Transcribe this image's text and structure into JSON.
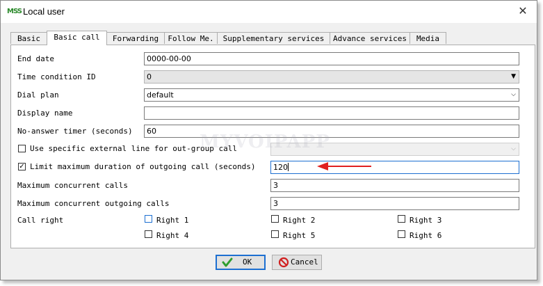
{
  "window": {
    "title": "Local user",
    "app_icon_text": "MSS"
  },
  "tabs": [
    {
      "label": "Basic"
    },
    {
      "label": "Basic call"
    },
    {
      "label": "Forwarding"
    },
    {
      "label": "Follow Me."
    },
    {
      "label": "Supplementary services"
    },
    {
      "label": "Advance services"
    },
    {
      "label": "Media"
    }
  ],
  "active_tab": "Basic call",
  "form": {
    "end_date": {
      "label": "End date",
      "value": "0000-00-00"
    },
    "time_condition": {
      "label": "Time condition ID",
      "value": "0"
    },
    "dial_plan": {
      "label": "Dial plan",
      "value": "default"
    },
    "display_name": {
      "label": "Display name",
      "value": ""
    },
    "no_answer_timer": {
      "label": "No-answer timer (seconds)",
      "value": "60"
    },
    "use_external_line": {
      "label": "Use specific external line for out-group call",
      "checked": false,
      "value": ""
    },
    "limit_duration": {
      "label": "Limit maximum duration of outgoing call (seconds)",
      "checked": true,
      "value": "120"
    },
    "max_concurrent": {
      "label": "Maximum concurrent calls",
      "value": "3"
    },
    "max_concurrent_out": {
      "label": "Maximum concurrent outgoing calls",
      "value": "3"
    },
    "call_right": {
      "label": "Call right",
      "items": [
        {
          "label": "Right 1",
          "checked": false
        },
        {
          "label": "Right 2",
          "checked": false
        },
        {
          "label": "Right 3",
          "checked": false
        },
        {
          "label": "Right 4",
          "checked": false
        },
        {
          "label": "Right 5",
          "checked": false
        },
        {
          "label": "Right 6",
          "checked": false
        }
      ]
    }
  },
  "buttons": {
    "ok": "OK",
    "cancel": "Cancel"
  },
  "watermark": "MYVOIPAPP",
  "colors": {
    "focus_border": "#1c6fd1",
    "annotation_arrow": "#e02020",
    "ok_check": "#2f9e2f",
    "cancel_icon": "#d02020"
  }
}
